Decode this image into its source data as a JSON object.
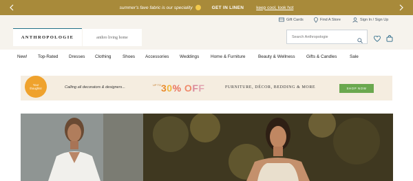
{
  "promo": {
    "message": "summer's fave fabric is our speciality",
    "cta": "GET IN LINEN",
    "link": "keep cool, look hot",
    "emoji_color": "#f2c94c",
    "bg_color": "#a88a3a"
  },
  "utility": {
    "gift_cards": "Gift Cards",
    "find_store": "Find A Store",
    "sign_in": "Sign In / Sign Up"
  },
  "header": {
    "logo": "ANTHROPOLOGIE",
    "home_logo": "anthro living home",
    "search_placeholder": "Search Anthropologie"
  },
  "nav": {
    "items": [
      "New!",
      "Top-Rated",
      "Dresses",
      "Clothing",
      "Shoes",
      "Accessories",
      "Weddings",
      "Home & Furniture",
      "Beauty & Wellness",
      "Gifts & Candles",
      "Sale"
    ]
  },
  "banner": {
    "badge": "Your thoughts!",
    "tagline": "Calling all decorators & designers...",
    "upto": "UP TO",
    "percent": "30% OFF",
    "categories": "FURNITURE, DÉCOR, BEDDING & MORE",
    "shop": "SHOP NOW",
    "badge_color": "#efa22d",
    "shop_color": "#6aa84f"
  }
}
